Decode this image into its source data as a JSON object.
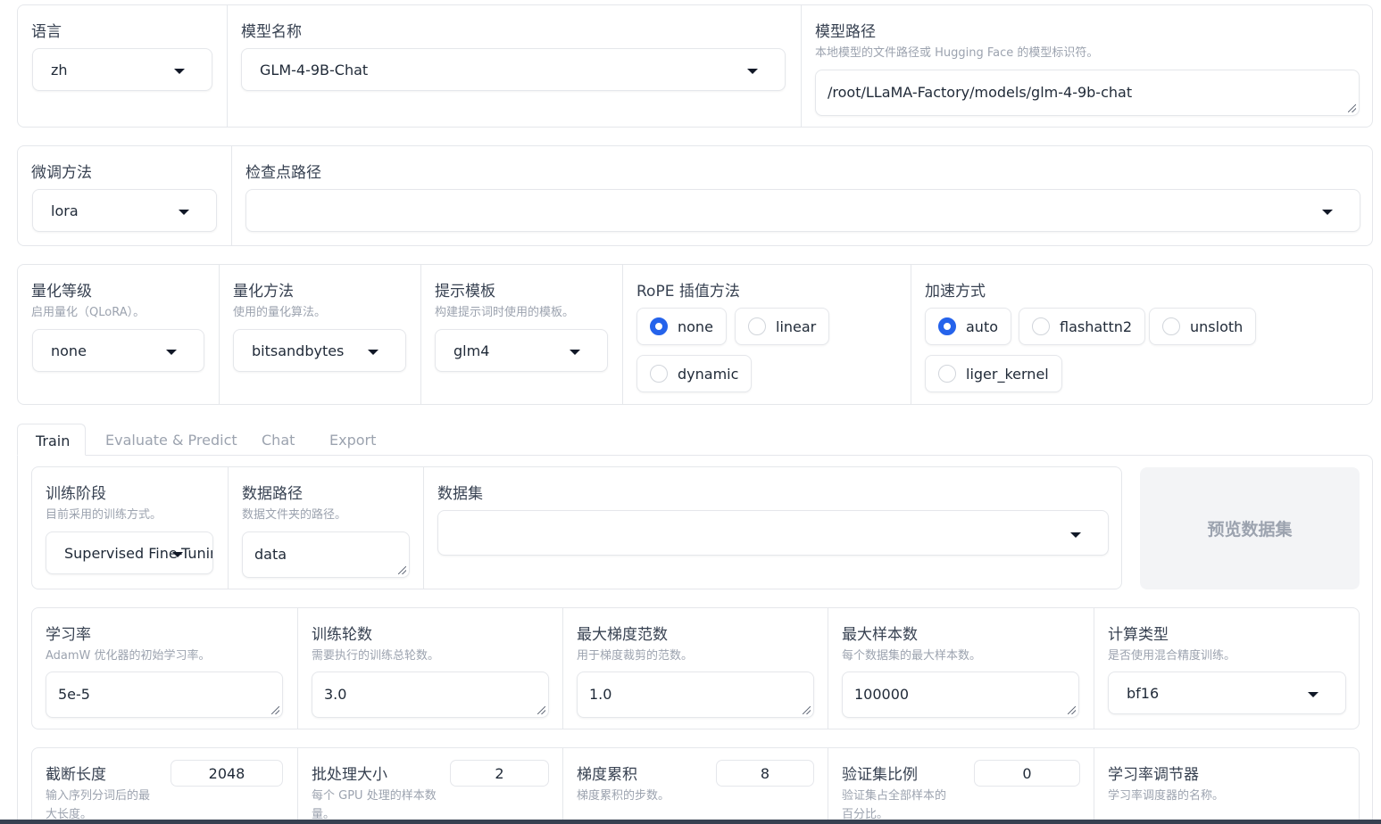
{
  "top": {
    "lang": {
      "label": "语言",
      "value": "zh"
    },
    "model_name": {
      "label": "模型名称",
      "value": "GLM-4-9B-Chat"
    },
    "model_path": {
      "label": "模型路径",
      "info": "本地模型的文件路径或 Hugging Face 的模型标识符。",
      "value": "/root/LLaMA-Factory/models/glm-4-9b-chat"
    }
  },
  "row2": {
    "finetune": {
      "label": "微调方法",
      "value": "lora"
    },
    "checkpoint": {
      "label": "检查点路径",
      "value": ""
    }
  },
  "row3": {
    "quant_bit": {
      "label": "量化等级",
      "info": "启用量化（QLoRA）。",
      "value": "none"
    },
    "quant_method": {
      "label": "量化方法",
      "info": "使用的量化算法。",
      "value": "bitsandbytes"
    },
    "template": {
      "label": "提示模板",
      "info": "构建提示词时使用的模板。",
      "value": "glm4"
    },
    "rope": {
      "label": "RoPE 插值方法",
      "options": [
        "none",
        "linear",
        "dynamic"
      ],
      "selected": "none"
    },
    "booster": {
      "label": "加速方式",
      "options": [
        "auto",
        "flashattn2",
        "unsloth",
        "liger_kernel"
      ],
      "selected": "auto"
    }
  },
  "tabs": [
    "Train",
    "Evaluate & Predict",
    "Chat",
    "Export"
  ],
  "active_tab": "Train",
  "train": {
    "stage": {
      "label": "训练阶段",
      "info": "目前采用的训练方式。",
      "value": "Supervised Fine-Tuning"
    },
    "dataset_dir": {
      "label": "数据路径",
      "info": "数据文件夹的路径。",
      "value": "data"
    },
    "dataset": {
      "label": "数据集",
      "value": ""
    },
    "preview_button": "预览数据集",
    "learning_rate": {
      "label": "学习率",
      "info": "AdamW 优化器的初始学习率。",
      "value": "5e-5"
    },
    "epochs": {
      "label": "训练轮数",
      "info": "需要执行的训练总轮数。",
      "value": "3.0"
    },
    "max_grad_norm": {
      "label": "最大梯度范数",
      "info": "用于梯度裁剪的范数。",
      "value": "1.0"
    },
    "max_samples": {
      "label": "最大样本数",
      "info": "每个数据集的最大样本数。",
      "value": "100000"
    },
    "compute_type": {
      "label": "计算类型",
      "info": "是否使用混合精度训练。",
      "value": "bf16"
    },
    "cutoff_len": {
      "label": "截断长度",
      "info_l1": "输入序列分词后的最",
      "info_l2": "大长度。",
      "value": "2048"
    },
    "batch_size": {
      "label": "批处理大小",
      "info_l1": "每个 GPU 处理的样本数",
      "info_l2": "量。",
      "value": "2"
    },
    "grad_accum": {
      "label": "梯度累积",
      "info_l1": "梯度累积的步数。",
      "value": "8"
    },
    "val_size": {
      "label": "验证集比例",
      "info_l1": "验证集占全部样本的",
      "info_l2": "百分比。",
      "value": "0"
    },
    "lr_scheduler": {
      "label": "学习率调节器",
      "info_l1": "学习率调度器的名称。"
    }
  },
  "colors": {
    "accent": "#2563eb",
    "border": "#e5e7eb",
    "muted": "#9ca3af"
  }
}
